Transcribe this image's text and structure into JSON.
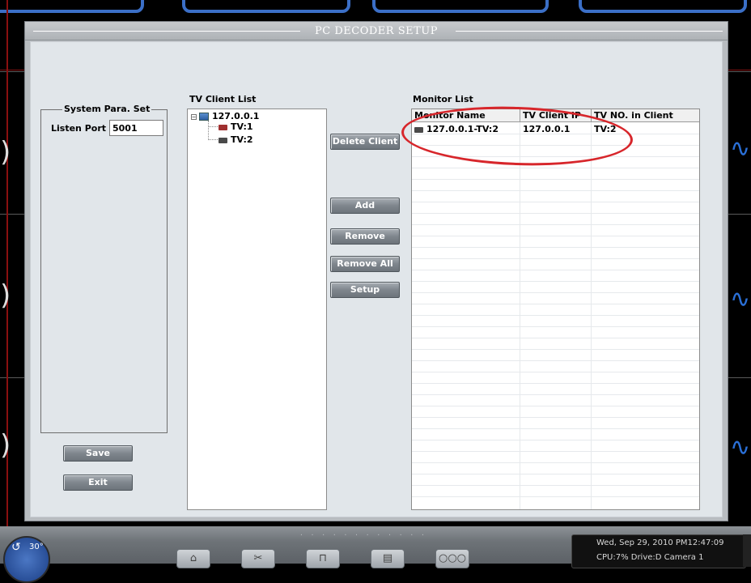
{
  "window": {
    "title": "PC DECODER SETUP"
  },
  "system_para": {
    "group_title": "System Para. Set",
    "listen_port_label": "Listen Port",
    "listen_port_value": "5001"
  },
  "tv_client_list": {
    "title": "TV Client List",
    "root": "127.0.0.1",
    "children": [
      "TV:1",
      "TV:2"
    ]
  },
  "buttons": {
    "delete_client": "Delete Client",
    "add": "Add",
    "remove": "Remove",
    "remove_all": "Remove All",
    "setup": "Setup",
    "save": "Save",
    "exit": "Exit"
  },
  "monitor_list": {
    "title": "Monitor List",
    "columns": [
      "Monitor Name",
      "TV Client IP",
      "TV NO. in Client"
    ],
    "rows": [
      {
        "monitor_name": "127.0.0.1-TV:2",
        "client_ip": "127.0.0.1",
        "tv_no": "TV:2"
      }
    ]
  },
  "taskbar": {
    "dial_label": "30°",
    "datetime": "Wed, Sep 29, 2010   PM12:47:09",
    "status": "CPU:7%  Drive:D      Camera 1"
  },
  "colors": {
    "annotation_ellipse": "#d7262b",
    "button_gradient_top": "#a7adb3",
    "button_gradient_bottom": "#6d747b",
    "window_bg": "#e1e6ea"
  }
}
